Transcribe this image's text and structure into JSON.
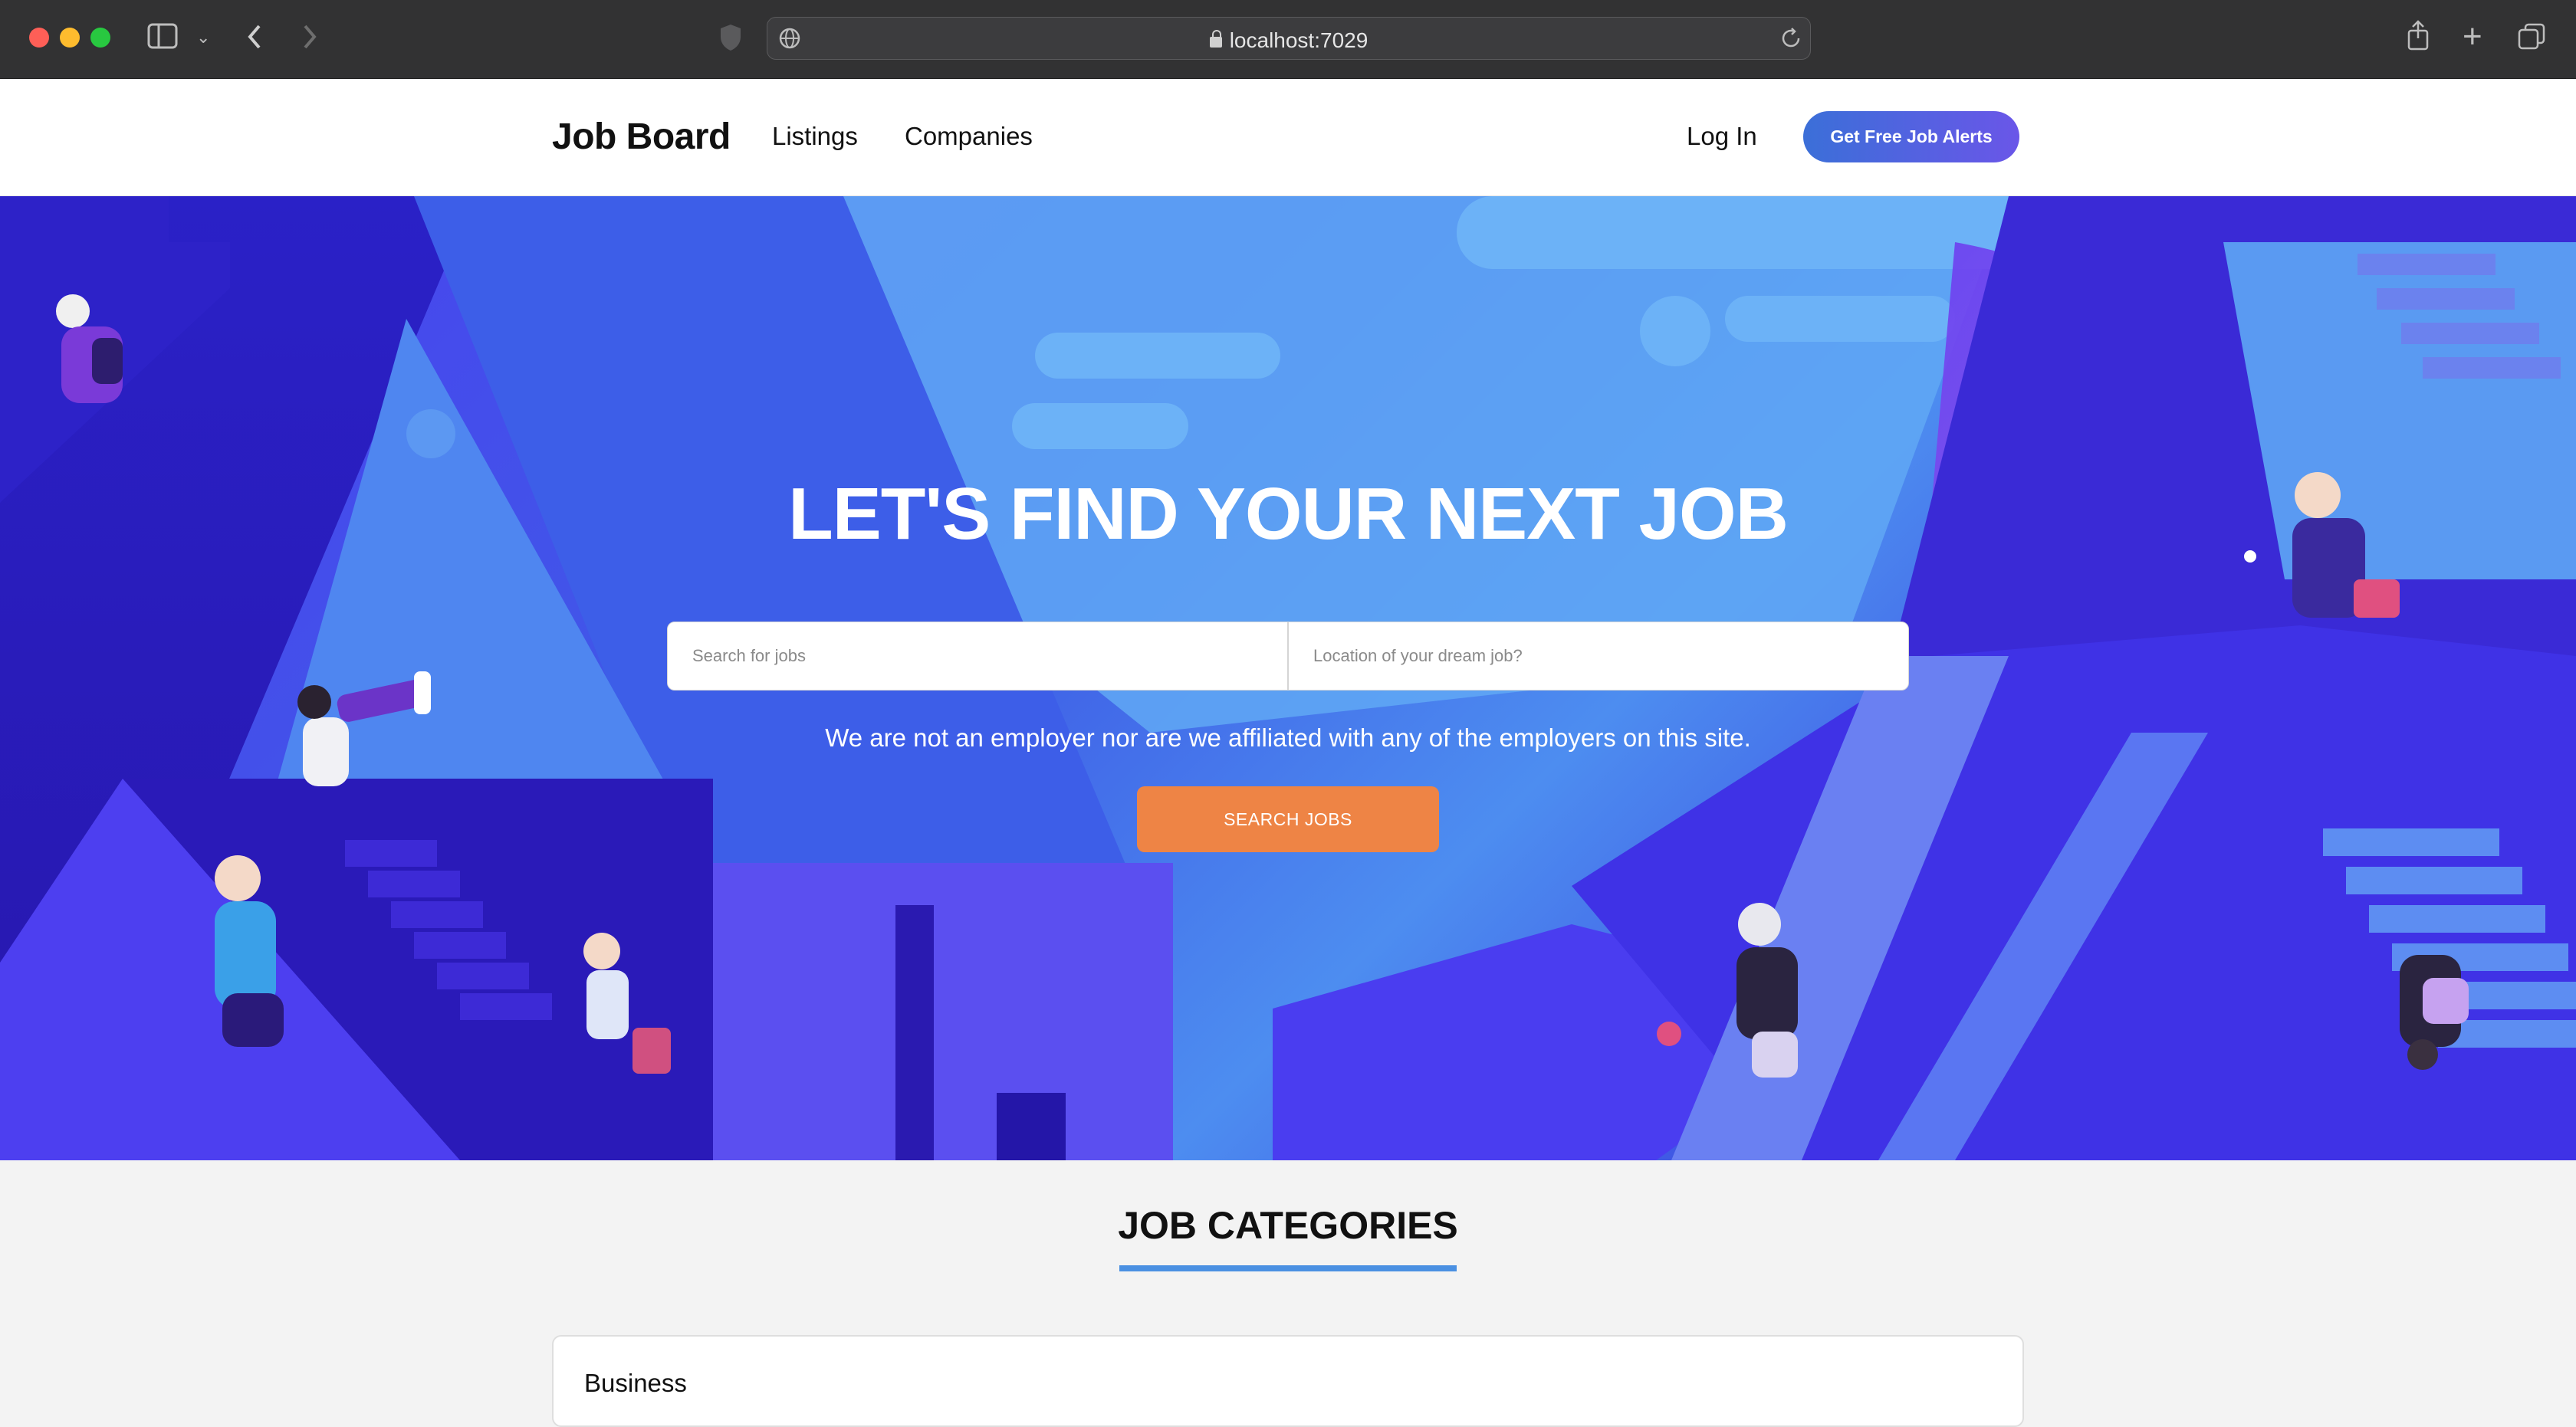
{
  "browser": {
    "url": "localhost:7029"
  },
  "navbar": {
    "brand": "Job Board",
    "links": [
      "Listings",
      "Companies"
    ],
    "login_label": "Log In",
    "alerts_label": "Get Free Job Alerts"
  },
  "hero": {
    "title": "LET'S FIND YOUR NEXT JOB",
    "search_placeholder": "Search for jobs",
    "location_placeholder": "Location of your dream job?",
    "disclaimer": "We are not an employer nor are we affiliated with any of the employers on this site.",
    "search_button": "SEARCH JOBS"
  },
  "categories": {
    "title": "JOB CATEGORIES",
    "items": [
      "Business"
    ]
  },
  "colors": {
    "accent_orange": "#ee8445",
    "accent_blue": "#4a90e2",
    "hero_blue": "#3e5de6"
  }
}
